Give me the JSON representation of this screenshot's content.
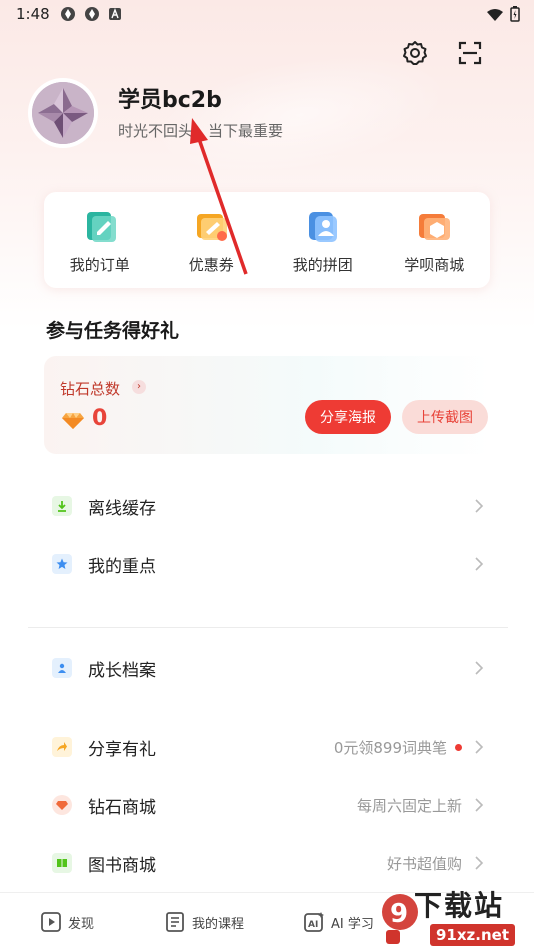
{
  "status_bar": {
    "time": "1:48"
  },
  "profile": {
    "username": "学员bc2b",
    "motto": "时光不回头，当下最重要"
  },
  "quick_menu": [
    {
      "label": "我的订单",
      "icon": "order-icon",
      "color": "#2bb5a0"
    },
    {
      "label": "优惠券",
      "icon": "coupon-icon",
      "color": "#f5a623"
    },
    {
      "label": "我的拼团",
      "icon": "group-icon",
      "color": "#4a90e2"
    },
    {
      "label": "学呗商城",
      "icon": "store-icon",
      "color": "#f57c3a"
    }
  ],
  "tasks": {
    "title": "参与任务得好礼",
    "diamond_label": "钻石总数",
    "diamond_count": "0",
    "share_label": "分享海报",
    "upload_label": "上传截图"
  },
  "menu_group_1": [
    {
      "label": "离线缓存",
      "icon": "download-icon",
      "color": "#52c41a"
    },
    {
      "label": "我的重点",
      "icon": "star-icon",
      "color": "#1890ff"
    }
  ],
  "menu_group_2": [
    {
      "label": "成长档案",
      "icon": "profile-card-icon",
      "color": "#1890ff"
    }
  ],
  "menu_group_3": [
    {
      "label": "分享有礼",
      "icon": "share-arrow-icon",
      "color": "#f5a623",
      "extra": "0元领899词典笔",
      "dot": true
    },
    {
      "label": "钻石商城",
      "icon": "diamond-store-icon",
      "color": "#f06a3a",
      "extra": "每周六固定上新",
      "dot": false
    },
    {
      "label": "图书商城",
      "icon": "book-icon",
      "color": "#52c41a",
      "extra": "好书超值购",
      "dot": false
    }
  ],
  "bottom_nav": [
    {
      "label": "发现",
      "icon": "play-icon"
    },
    {
      "label": "我的课程",
      "icon": "course-list-icon"
    },
    {
      "label": "AI 学习",
      "icon": "ai-icon"
    }
  ],
  "watermark": {
    "big": "下载站",
    "small": "91xz.net"
  }
}
